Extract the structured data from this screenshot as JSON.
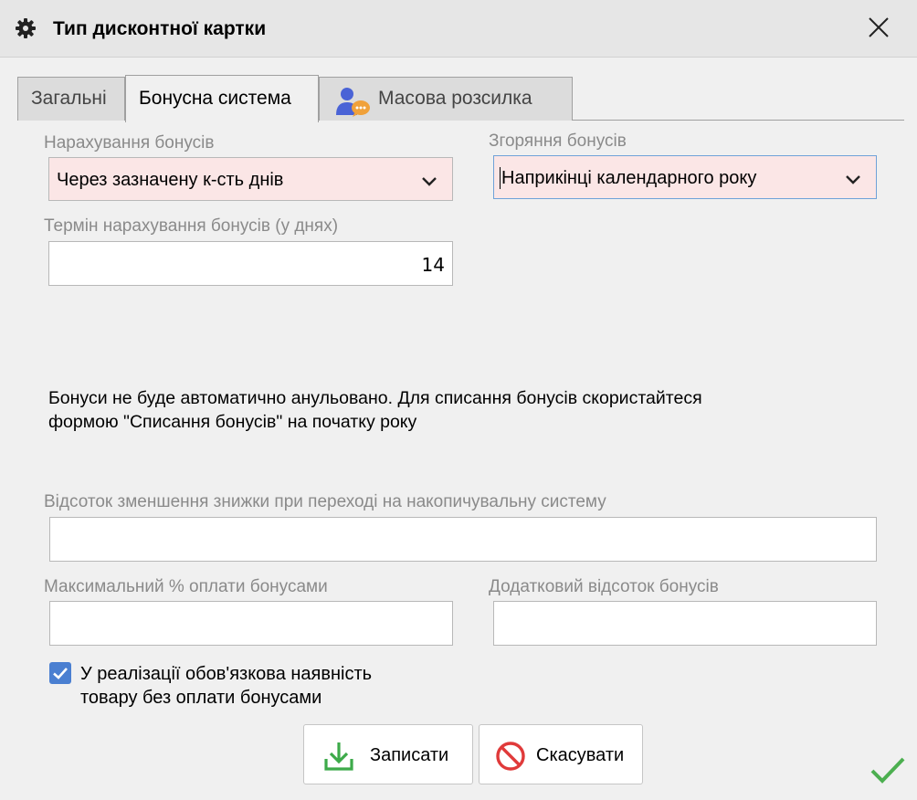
{
  "window": {
    "title": "Тип дисконтної картки",
    "title_icon": "gear-icon",
    "close_icon": "close-icon"
  },
  "tabs": [
    {
      "label": "Загальні",
      "active": false
    },
    {
      "label": "Бонусна система",
      "active": true
    },
    {
      "label": "Масова розсилка",
      "active": false,
      "icon": "user-chat-icon"
    }
  ],
  "form": {
    "accrual": {
      "label": "Нарахування бонусів",
      "value": "Через зазначену к-сть днів"
    },
    "burn": {
      "label": "Згоряння бонусів",
      "value": "Наприкінці календарного року"
    },
    "accrual_term": {
      "label": "Термін нарахування бонусів (у днях)",
      "value": "14"
    },
    "info_line1": "Бонуси не буде автоматично анульовано. Для списання бонусів скористайтеся",
    "info_line2": "формою \"Списання бонусів\" на початку року",
    "discount_reduction": {
      "label": "Відсоток зменшення знижки при переході на накопичувальну систему",
      "value": ""
    },
    "max_payment": {
      "label": "Максимальний % оплати бонусами",
      "value": ""
    },
    "extra_percent": {
      "label": "Додатковий відсоток бонусів",
      "value": ""
    },
    "mandatory_goods": {
      "checked": true,
      "line1": "У реалізації обов'язкова наявність",
      "line2": "товару без оплати бонусами"
    }
  },
  "buttons": {
    "save_label": "Записати",
    "cancel_label": "Скасувати"
  },
  "colors": {
    "required_field_bg": "#fbe6e6",
    "checkbox_accent": "#4a7fd1",
    "save_icon": "#3daa4a",
    "cancel_icon": "#e03a3a",
    "ok_mark": "#4caf50"
  }
}
